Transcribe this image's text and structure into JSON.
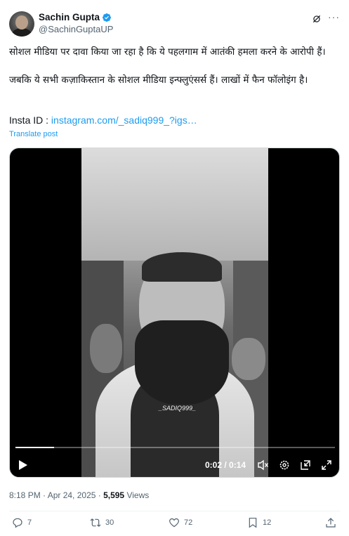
{
  "author": {
    "display_name": "Sachin Gupta",
    "handle": "@SachinGuptaUP",
    "verified_color": "#1d9bf0"
  },
  "tweet": {
    "paragraph_1": "सोशल मीडिया पर दावा किया जा रहा है कि ये पहलगाम में आतंकी हमला करने के आरोपी हैं।",
    "paragraph_2": "जबकि ये सभी कज़ाकिस्तान के सोशल मीडिया इन्फ्लुएंसर्स हैं। लाखों में फैन फॉलोइंग है।",
    "insta_label": "Insta ID :",
    "insta_link": "instagram.com/_sadiq999_?igs…",
    "translate_label": "Translate post"
  },
  "video": {
    "watermark": "_SADIQ999_",
    "time": "0:02 / 0:14",
    "progress_fraction": 0.12
  },
  "meta": {
    "timestamp": "8:18 PM · Apr 24, 2025 · ",
    "views_count": "5,595",
    "views_label": " Views"
  },
  "actions": {
    "replies": "7",
    "reposts": "30",
    "likes": "72",
    "bookmarks": "12"
  },
  "colors": {
    "link": "#1d9bf0",
    "secondary_text": "#536471",
    "primary_text": "#0f1419"
  }
}
